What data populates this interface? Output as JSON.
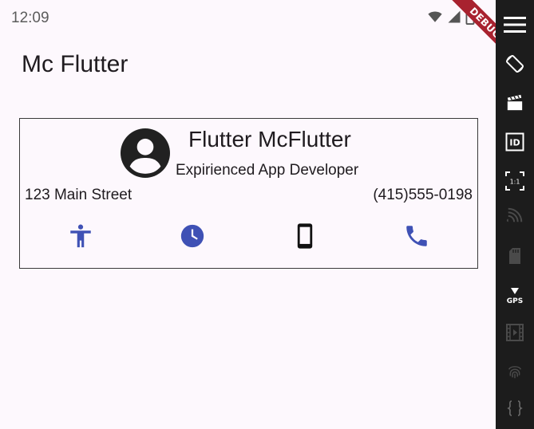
{
  "status_bar": {
    "time": "12:09",
    "icons": [
      "wifi-icon",
      "cell-signal-icon",
      "battery-icon"
    ]
  },
  "debug_banner": "DEBUG",
  "app_bar": {
    "title": "Mc Flutter"
  },
  "card": {
    "name": "Flutter McFlutter",
    "role": "Expirienced App Developer",
    "address": "123 Main Street",
    "phone": "(415)555-0198",
    "icons": [
      "accessibility-icon",
      "clock-icon",
      "smartphone-icon",
      "phone-icon"
    ],
    "icon_color": "#3f51b5"
  },
  "toolbar": {
    "icons": [
      "menu-icon",
      "rotate-icon",
      "screen-record-icon",
      "id-icon",
      "scale-icon",
      "cast-icon",
      "sd-card-icon",
      "gps-icon",
      "video-icon",
      "fingerprint-icon",
      "braces-icon"
    ],
    "scale_label": "1:1",
    "gps_label": "GPS",
    "id_label": "ID"
  },
  "colors": {
    "background": "#fdf8fd",
    "toolbar": "#1c1c1c",
    "accent": "#3f51b5",
    "debug": "#a8222f"
  }
}
